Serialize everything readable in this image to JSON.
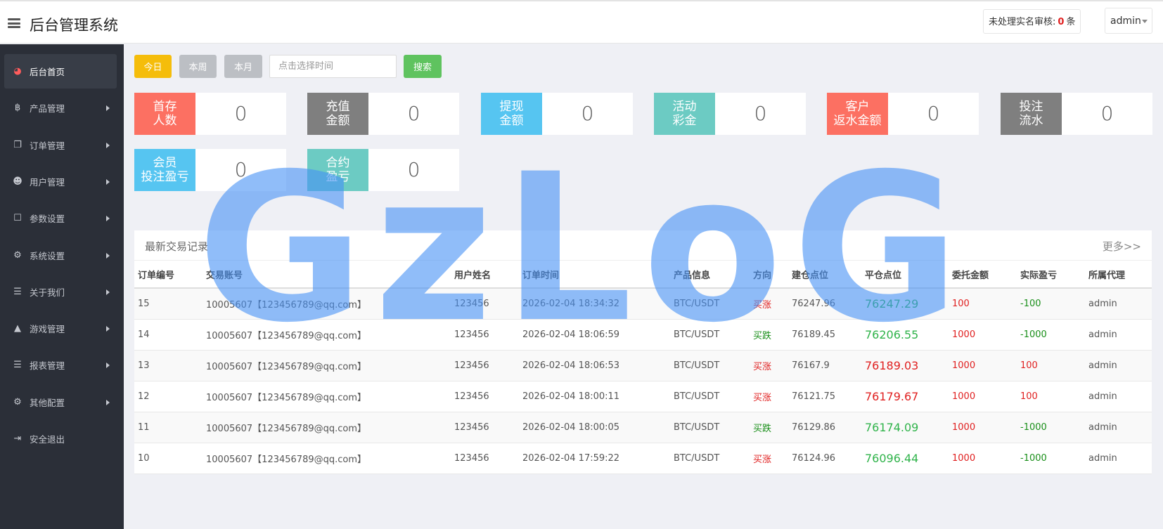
{
  "header": {
    "title": "后台管理系统",
    "pending_label": "未处理实名审核:",
    "pending_count": "0",
    "pending_unit": "条",
    "user": "admin"
  },
  "sidebar": {
    "items": [
      {
        "label": "后台首页",
        "icon": "dashboard-icon",
        "active": true
      },
      {
        "label": "产品管理",
        "icon": "bitcoin-icon"
      },
      {
        "label": "订单管理",
        "icon": "copy-icon"
      },
      {
        "label": "用户管理",
        "icon": "user-icon"
      },
      {
        "label": "参数设置",
        "icon": "file-icon"
      },
      {
        "label": "系统设置",
        "icon": "gears-icon"
      },
      {
        "label": "关于我们",
        "icon": "list-icon"
      },
      {
        "label": "游戏管理",
        "icon": "bell-icon"
      },
      {
        "label": "报表管理",
        "icon": "list-icon"
      },
      {
        "label": "其他配置",
        "icon": "gear-icon"
      },
      {
        "label": "安全退出",
        "icon": "logout-icon"
      }
    ]
  },
  "filters": {
    "today": "今日",
    "week": "本周",
    "month": "本月",
    "date_placeholder": "点击选择时间",
    "search": "搜索"
  },
  "stats": [
    {
      "label": "首存\n人数",
      "value": "0",
      "color": "#fc7062"
    },
    {
      "label": "充值\n金额",
      "value": "0",
      "color": "#7f7f7f"
    },
    {
      "label": "提现\n金额",
      "value": "0",
      "color": "#56c5f1"
    },
    {
      "label": "活动\n彩金",
      "value": "0",
      "color": "#6ccbc3"
    },
    {
      "label": "客户\n返水金额",
      "value": "0",
      "color": "#fc7062"
    },
    {
      "label": "投注\n流水",
      "value": "0",
      "color": "#7f7f7f"
    },
    {
      "label": "会员\n投注盈亏",
      "value": "0",
      "color": "#56c5f1"
    },
    {
      "label": "合约\n盈亏",
      "value": "0",
      "color": "#6ccbc3"
    }
  ],
  "records": {
    "title": "最新交易记录",
    "more": "更多>>",
    "columns": [
      "订单编号",
      "交易账号",
      "用户姓名",
      "订单时间",
      "产品信息",
      "方向",
      "建仓点位",
      "平仓点位",
      "委托金额",
      "实际盈亏",
      "所属代理"
    ],
    "rows": [
      {
        "id": "15",
        "account": "10005607【123456789@qq.com】",
        "name": "123456",
        "time": "2026-02-04 18:34:32",
        "product": "BTC/USDT",
        "direction": "买涨",
        "open": "76247.96",
        "close": "76247.29",
        "amount": "100",
        "pnl": "-100",
        "agent": "admin"
      },
      {
        "id": "14",
        "account": "10005607【123456789@qq.com】",
        "name": "123456",
        "time": "2026-02-04 18:06:59",
        "product": "BTC/USDT",
        "direction": "买跌",
        "open": "76189.45",
        "close": "76206.55",
        "amount": "1000",
        "pnl": "-1000",
        "agent": "admin"
      },
      {
        "id": "13",
        "account": "10005607【123456789@qq.com】",
        "name": "123456",
        "time": "2026-02-04 18:06:53",
        "product": "BTC/USDT",
        "direction": "买涨",
        "open": "76167.9",
        "close": "76189.03",
        "amount": "1000",
        "pnl": "100",
        "agent": "admin"
      },
      {
        "id": "12",
        "account": "10005607【123456789@qq.com】",
        "name": "123456",
        "time": "2026-02-04 18:00:11",
        "product": "BTC/USDT",
        "direction": "买涨",
        "open": "76121.75",
        "close": "76179.67",
        "amount": "1000",
        "pnl": "100",
        "agent": "admin"
      },
      {
        "id": "11",
        "account": "10005607【123456789@qq.com】",
        "name": "123456",
        "time": "2026-02-04 18:00:05",
        "product": "BTC/USDT",
        "direction": "买跌",
        "open": "76129.86",
        "close": "76174.09",
        "amount": "1000",
        "pnl": "-1000",
        "agent": "admin"
      },
      {
        "id": "10",
        "account": "10005607【123456789@qq.com】",
        "name": "123456",
        "time": "2026-02-04 17:59:22",
        "product": "BTC/USDT",
        "direction": "买涨",
        "open": "76124.96",
        "close": "76096.44",
        "amount": "1000",
        "pnl": "-1000",
        "agent": "admin"
      }
    ]
  },
  "watermark": "GzLoG"
}
